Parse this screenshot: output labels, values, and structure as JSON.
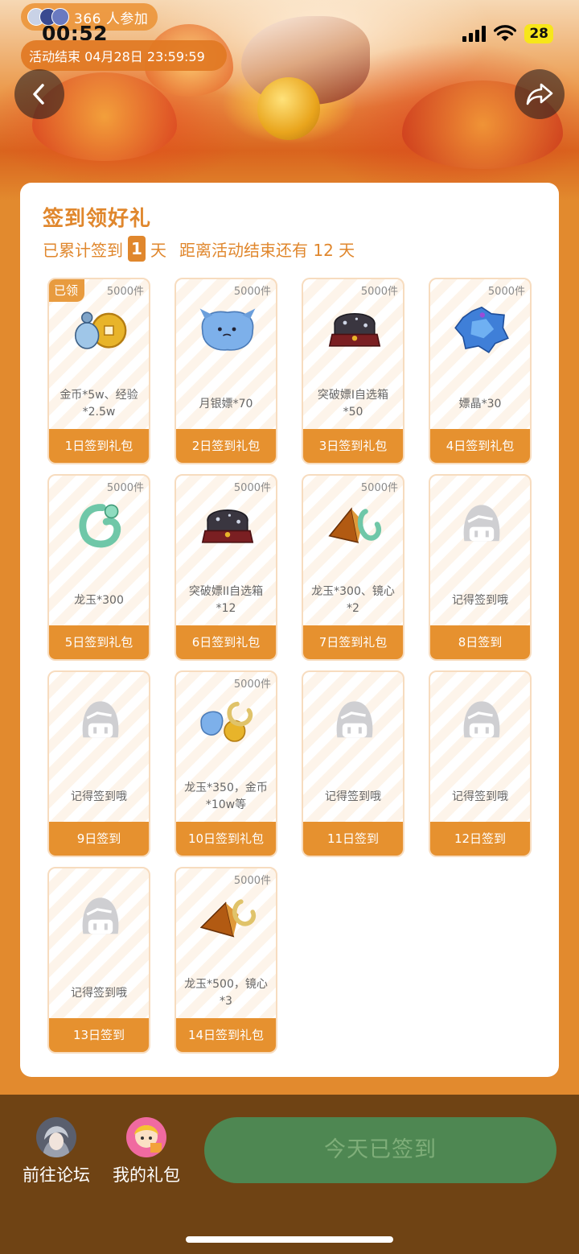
{
  "status_bar": {
    "participants": "366 人参加",
    "time": "00:52",
    "battery": "28",
    "activity_end": "活动结束 04月28日 23:59:59"
  },
  "header": {
    "back_icon": "chevron-left-icon",
    "share_icon": "share-arrow-icon"
  },
  "card": {
    "title": "签到领好礼",
    "subtitle_prefix": "已累计签到",
    "signed_days": "1",
    "day_unit": "天",
    "remaining": "距离活动结束还有 12 天"
  },
  "tiles": [
    {
      "stock": "5000件",
      "name": "金币*5w、经验*2.5w",
      "footer": "1日签到礼包",
      "claimed": "已领",
      "art": "coins-bottle-icon"
    },
    {
      "stock": "5000件",
      "name": "月银嫖*70",
      "footer": "2日签到礼包",
      "art": "blue-creature-icon"
    },
    {
      "stock": "5000件",
      "name": "突破嫖I自选箱*50",
      "footer": "3日签到礼包",
      "art": "dark-chest-icon"
    },
    {
      "stock": "5000件",
      "name": "嫖晶*30",
      "footer": "4日签到礼包",
      "art": "blue-crystal-icon"
    },
    {
      "stock": "5000件",
      "name": "龙玉*300",
      "footer": "5日签到礼包",
      "art": "jade-dragon-icon"
    },
    {
      "stock": "5000件",
      "name": "突破嫖II自选箱*12",
      "footer": "6日签到礼包",
      "art": "dark-chest-icon"
    },
    {
      "stock": "5000件",
      "name": "龙玉*300、镜心*2",
      "footer": "7日签到礼包",
      "art": "jade-pyramid-icon"
    },
    {
      "stock": "",
      "name": "记得签到哦",
      "footer": "8日签到",
      "art": "placeholder-avatar-icon"
    },
    {
      "stock": "",
      "name": "记得签到哦",
      "footer": "9日签到",
      "art": "placeholder-avatar-icon"
    },
    {
      "stock": "5000件",
      "name": "龙玉*350，金币*10w等",
      "footer": "10日签到礼包",
      "art": "gift-bundle-icon"
    },
    {
      "stock": "",
      "name": "记得签到哦",
      "footer": "11日签到",
      "art": "placeholder-avatar-icon"
    },
    {
      "stock": "",
      "name": "记得签到哦",
      "footer": "12日签到",
      "art": "placeholder-avatar-icon"
    },
    {
      "stock": "",
      "name": "记得签到哦",
      "footer": "13日签到",
      "art": "placeholder-avatar-icon"
    },
    {
      "stock": "5000件",
      "name": "龙玉*500，镜心*3",
      "footer": "14日签到礼包",
      "art": "gold-pyramid-icon"
    }
  ],
  "bottom_bar": {
    "forum_label": "前往论坛",
    "gifts_label": "我的礼包",
    "signin_button": "今天已签到"
  },
  "colors": {
    "accent": "#e0872d",
    "tile_footer": "#e6912f",
    "bottom_bar": "#6f4314",
    "signin_button": "#4e8752"
  }
}
